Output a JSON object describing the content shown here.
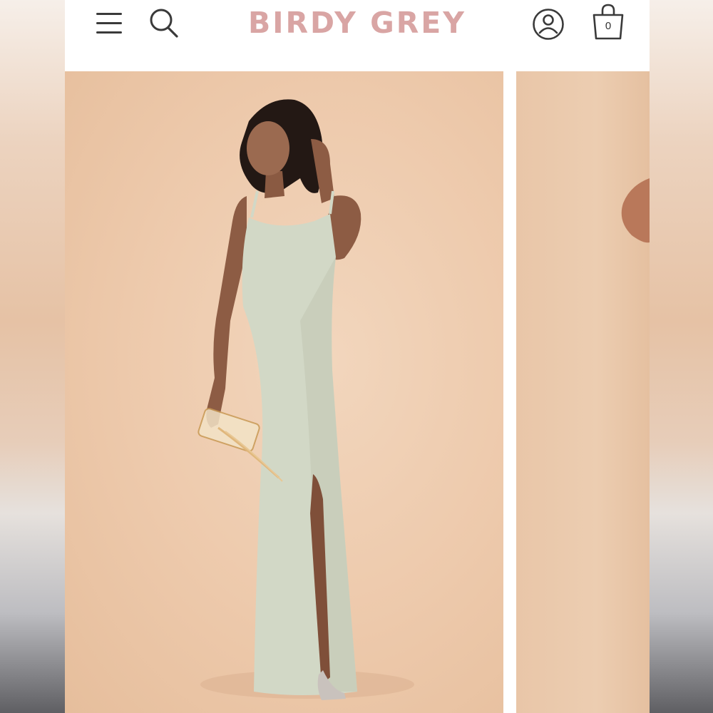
{
  "header": {
    "logo_text": "BIRDY GREY",
    "menu_icon": "hamburger-menu-icon",
    "search_icon": "search-icon",
    "account_icon": "account-icon",
    "bag_icon": "shopping-bag-icon",
    "bag_count": "0"
  },
  "colors": {
    "logo": "#d9a5a4",
    "backdrop": "#edc9ab",
    "dress": "#d2d8c6"
  },
  "gallery": {
    "slides": [
      "product-photo-front",
      "product-photo-next"
    ]
  }
}
